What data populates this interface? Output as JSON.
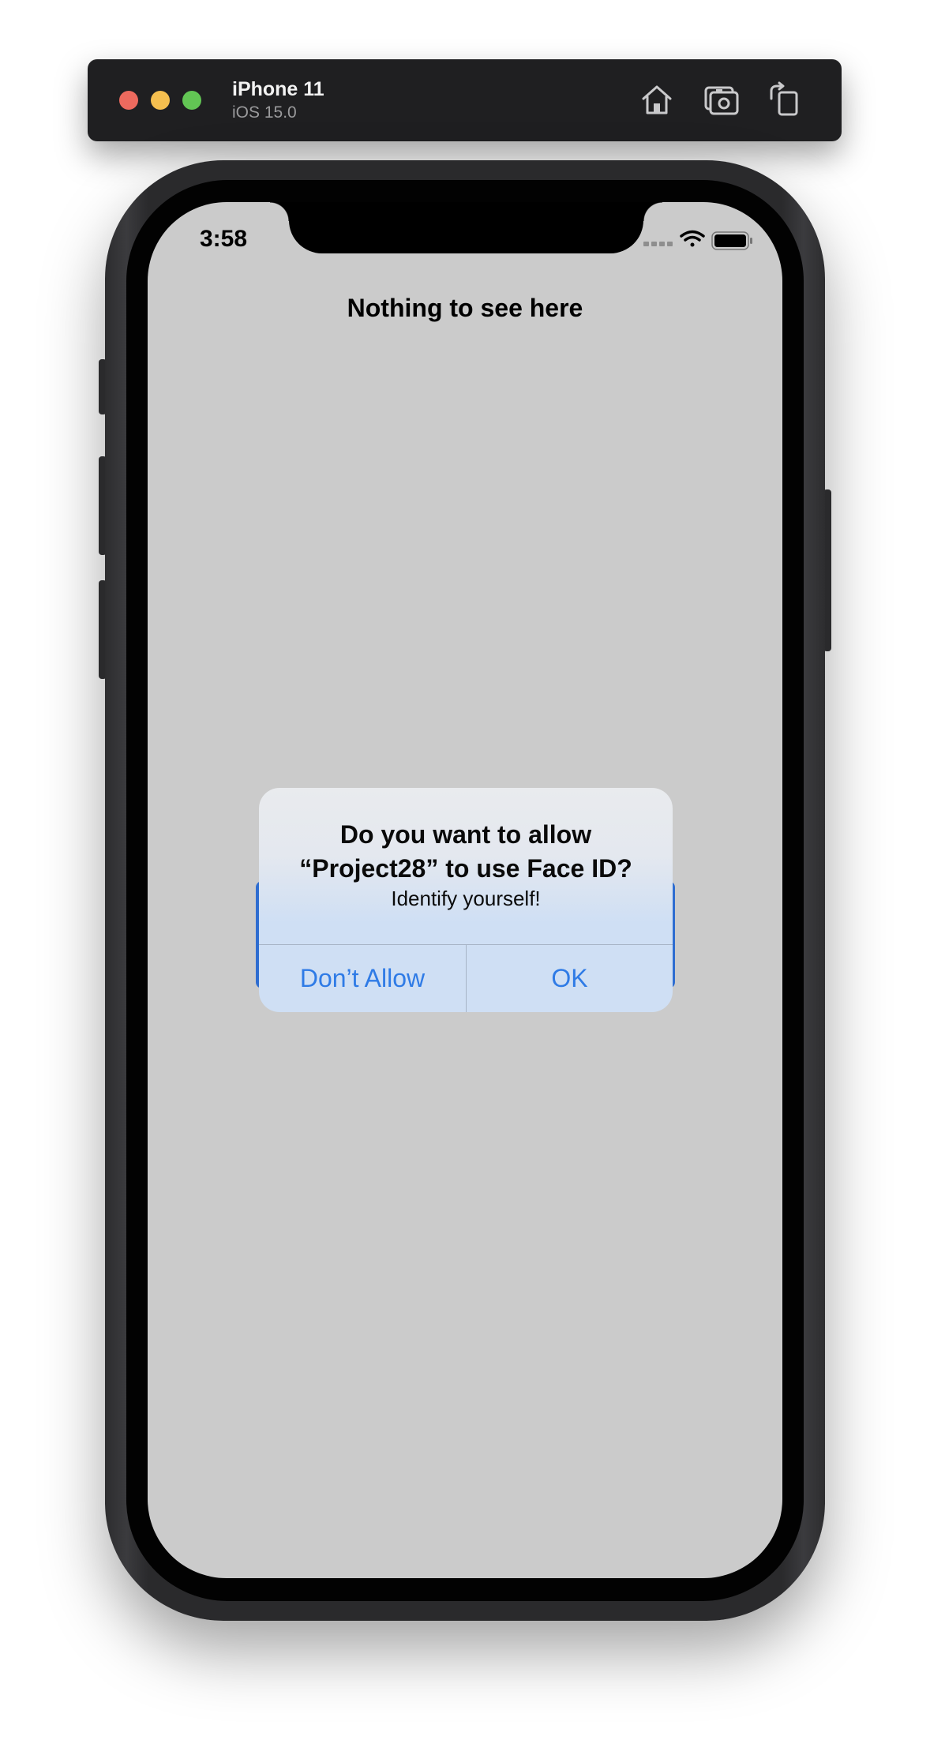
{
  "simulator": {
    "device_name": "iPhone 11",
    "os_version": "iOS 15.0",
    "toolbar_icons": [
      "home-icon",
      "screenshot-icon",
      "rotate-icon"
    ]
  },
  "status_bar": {
    "time": "3:58",
    "icons": [
      "cellular-signal-icon",
      "wifi-icon",
      "battery-icon"
    ]
  },
  "screen": {
    "title": "Nothing to see here"
  },
  "alert": {
    "title": "Do you want to allow “Project28” to use Face ID?",
    "message": "Identify yourself!",
    "deny_label": "Don’t Allow",
    "ok_label": "OK"
  },
  "colors": {
    "screen_background": "#cbcbcb",
    "alert_button_text": "#2f7be6",
    "underlying_button": "#2e6dd1"
  }
}
